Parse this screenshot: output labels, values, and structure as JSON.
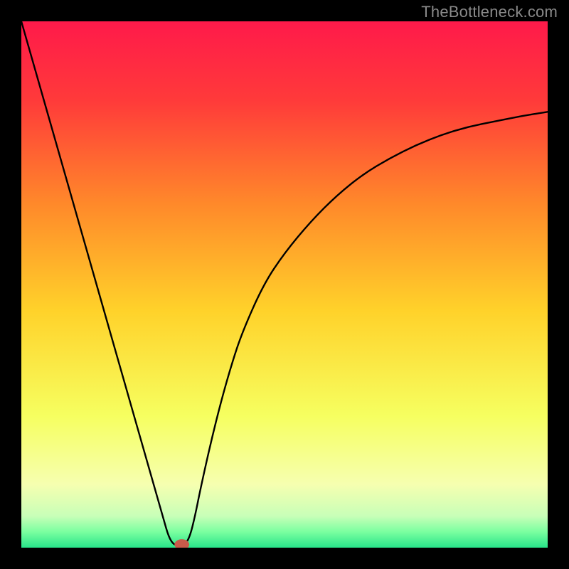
{
  "watermark": "TheBottleneck.com",
  "chart_data": {
    "type": "line",
    "title": "",
    "xlabel": "",
    "ylabel": "",
    "xlim": [
      0,
      100
    ],
    "ylim": [
      0,
      100
    ],
    "grid": false,
    "legend": false,
    "background_gradient": {
      "stops": [
        {
          "pos": 0.0,
          "color": "#ff1a4a"
        },
        {
          "pos": 0.15,
          "color": "#ff3a3a"
        },
        {
          "pos": 0.35,
          "color": "#ff8a2a"
        },
        {
          "pos": 0.55,
          "color": "#ffd22a"
        },
        {
          "pos": 0.75,
          "color": "#f6ff60"
        },
        {
          "pos": 0.88,
          "color": "#f6ffb0"
        },
        {
          "pos": 0.94,
          "color": "#c8ffb8"
        },
        {
          "pos": 0.97,
          "color": "#7affa0"
        },
        {
          "pos": 1.0,
          "color": "#28e48a"
        }
      ]
    },
    "series": [
      {
        "name": "bottleneck-curve",
        "x": [
          0,
          2,
          4,
          6,
          8,
          10,
          12,
          14,
          16,
          18,
          20,
          22,
          24,
          26,
          27,
          28,
          29,
          30,
          31,
          32,
          33,
          34,
          36,
          38,
          40,
          42,
          46,
          50,
          55,
          60,
          65,
          70,
          75,
          80,
          85,
          90,
          95,
          100
        ],
        "y": [
          100,
          93,
          86,
          79,
          72,
          65,
          58,
          51,
          44,
          37,
          30,
          23,
          16,
          9,
          5.5,
          2,
          0.5,
          0.5,
          0.5,
          2,
          6,
          11,
          20,
          28,
          35,
          41,
          50,
          56,
          62,
          67,
          71,
          74,
          76.5,
          78.5,
          80,
          81,
          82,
          82.8
        ]
      }
    ],
    "marker": {
      "name": "current-point",
      "x": 30.5,
      "y": 0.6,
      "rx": 1.4,
      "ry": 1.0,
      "color": "#c95a4a"
    }
  }
}
